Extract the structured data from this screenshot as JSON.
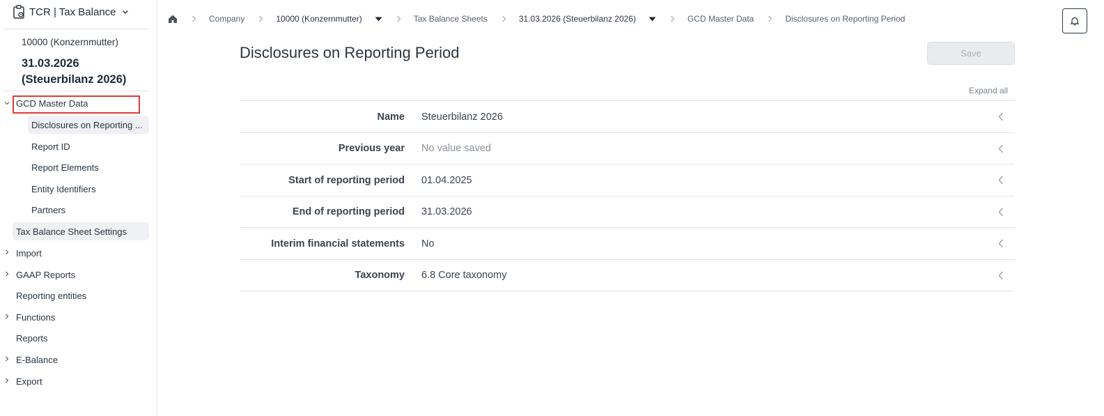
{
  "app": {
    "title": "TCR | Tax Balance"
  },
  "context": {
    "company": "10000 (Konzernmutter)",
    "period": "31.03.2026 (Steuerbilanz 2026)"
  },
  "sidebar": {
    "items": [
      {
        "label": "GCD Master Data",
        "expanded": true
      },
      {
        "label": "Disclosures on Reporting ..."
      },
      {
        "label": "Report ID"
      },
      {
        "label": "Report Elements"
      },
      {
        "label": "Entity Identifiers"
      },
      {
        "label": "Partners"
      },
      {
        "label": "Tax Balance Sheet Settings"
      },
      {
        "label": "Import"
      },
      {
        "label": "GAAP Reports"
      },
      {
        "label": "Reporting entities"
      },
      {
        "label": "Functions"
      },
      {
        "label": "Reports"
      },
      {
        "label": "E-Balance"
      },
      {
        "label": "Export"
      }
    ]
  },
  "breadcrumb": {
    "items": [
      "Company",
      "10000 (Konzernmutter)",
      "Tax Balance Sheets",
      "31.03.2026 (Steuerbilanz 2026)",
      "GCD Master Data",
      "Disclosures on Reporting Period"
    ]
  },
  "main": {
    "title": "Disclosures on Reporting Period",
    "save_label": "Save",
    "expand_all_label": "Expand all",
    "rows": [
      {
        "label": "Name",
        "value": "Steuerbilanz 2026"
      },
      {
        "label": "Previous year",
        "value": "No value saved"
      },
      {
        "label": "Start of reporting period",
        "value": "01.04.2025"
      },
      {
        "label": "End of reporting period",
        "value": "31.03.2026"
      },
      {
        "label": "Interim financial statements",
        "value": "No"
      },
      {
        "label": "Taxonomy",
        "value": "6.8 Core taxonomy"
      }
    ]
  },
  "colors": {
    "text": "#2b3440",
    "active_bg": "#eef0f3",
    "highlight": "#e53935",
    "disabled_btn": "#e9ecef"
  },
  "icons": [
    "clipboard-icon",
    "chevron-down-icon",
    "home-icon",
    "chevron-right-icon",
    "caret-down-icon",
    "bell-icon",
    "chevron-left-icon"
  ]
}
